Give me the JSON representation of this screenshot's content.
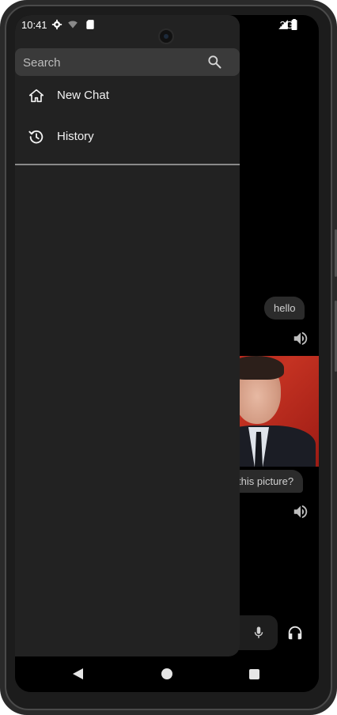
{
  "status_bar": {
    "time": "10:41",
    "network": "3G"
  },
  "drawer": {
    "search": {
      "placeholder": "Search"
    },
    "items": [
      {
        "label": "New Chat",
        "icon": "home-icon"
      },
      {
        "label": "History",
        "icon": "history-icon"
      }
    ]
  },
  "chat": {
    "messages": [
      {
        "text": "hello"
      },
      {
        "text": "this picture?"
      }
    ]
  },
  "colors": {
    "drawer_bg": "#222222",
    "search_bg": "#3a3a3a",
    "bubble_bg": "#2b2b2b",
    "screen_bg": "#000000"
  }
}
